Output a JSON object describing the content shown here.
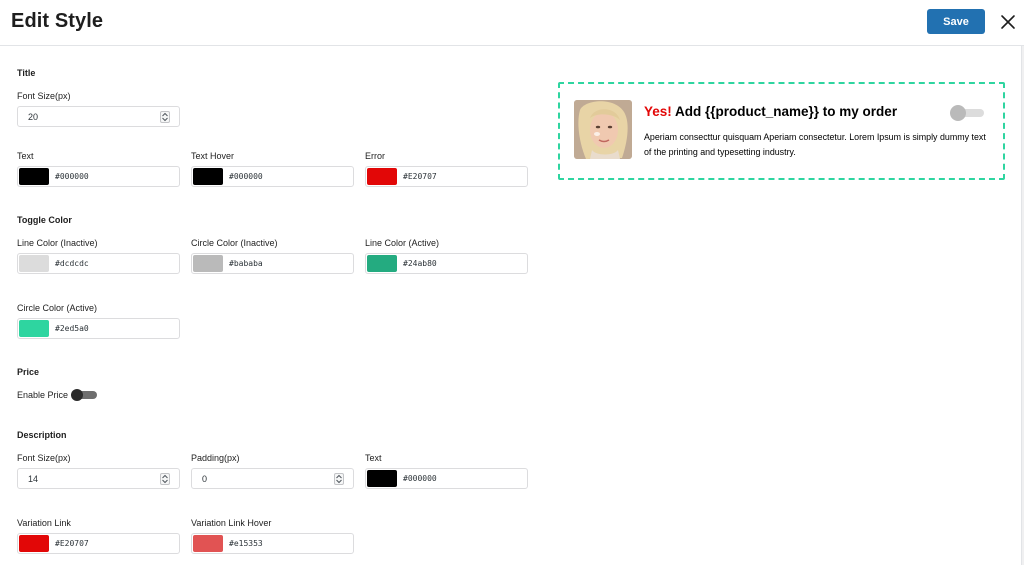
{
  "header": {
    "title": "Edit Style",
    "save_label": "Save",
    "close_icon": "close-icon"
  },
  "title_section": {
    "heading": "Title",
    "font_size_label": "Font Size(px)",
    "font_size_value": "20",
    "text_label": "Text",
    "text_color": "#000000",
    "text_hover_label": "Text Hover",
    "text_hover_color": "#000000",
    "error_label": "Error",
    "error_color": "#E20707"
  },
  "toggle_color_section": {
    "heading": "Toggle Color",
    "line_inactive_label": "Line Color (Inactive)",
    "line_inactive_color": "#dcdcdc",
    "circle_inactive_label": "Circle Color (Inactive)",
    "circle_inactive_color": "#bababa",
    "line_active_label": "Line Color (Active)",
    "line_active_color": "#24ab80",
    "circle_active_label": "Circle Color (Active)",
    "circle_active_color": "#2ed5a0"
  },
  "price_section": {
    "heading": "Price",
    "enable_price_label": "Enable Price",
    "enable_price_on": false
  },
  "description_section": {
    "heading": "Description",
    "font_size_label": "Font Size(px)",
    "font_size_value": "14",
    "padding_label": "Padding(px)",
    "padding_value": "0",
    "text_label": "Text",
    "text_color": "#000000",
    "variation_link_label": "Variation Link",
    "variation_link_color": "#E20707",
    "variation_link_hover_label": "Variation Link Hover",
    "variation_link_hover_color": "#e15353"
  },
  "preview": {
    "title_yes": "Yes!",
    "title_rest": " Add {{product_name}} to my order",
    "description": "Aperiam consecttur quisquam Aperiam consectetur. Lorem Ipsum is simply dummy text of the printing and typesetting industry.",
    "toggle_on": false,
    "border_color": "#2ed5a0"
  },
  "colors": {
    "accent": "#2271b1",
    "error": "#E20707"
  }
}
